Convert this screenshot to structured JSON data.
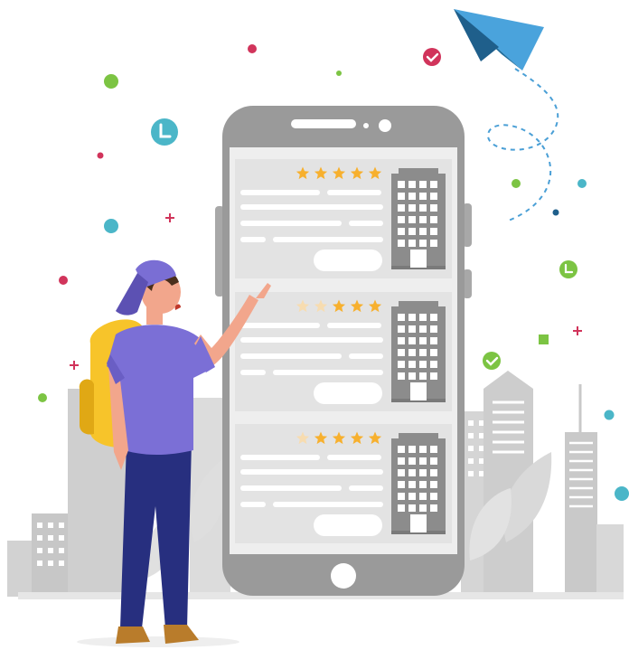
{
  "illustration": {
    "subject": "traveler-choosing-hotel-on-phone",
    "colors": {
      "phone_frame": "#9a9a9a",
      "phone_screen": "#eeeeee",
      "card": "#e3e3e3",
      "card_line": "#ffffff",
      "star_active": "#f7b02e",
      "star_inactive": "#f7dcb0",
      "building": "#8c8c8c",
      "city_silhouette": "#d2d2d2",
      "plane_dark": "#1f6c9c",
      "plane_light": "#4aa3dc",
      "dash_path": "#4a9fd6",
      "dot_green": "#7cc443",
      "dot_pink": "#d1345b",
      "dot_teal": "#4bb6c8",
      "dot_navy": "#1f5f8b",
      "shirt": "#7b6fd6",
      "pants": "#272f7f",
      "cap": "#7a6ed4",
      "backpack": "#f7c42a",
      "shoes": "#b97c2b",
      "skin": "#f2a68c",
      "hair": "#4a2e1b"
    },
    "hotel_cards": [
      {
        "rating": 5
      },
      {
        "rating": 3
      },
      {
        "rating": 4
      }
    ],
    "icons": [
      "paper-plane-icon",
      "clock-icon",
      "check-icon",
      "plus-icon",
      "star-icon",
      "building-icon",
      "home-button-icon"
    ]
  }
}
